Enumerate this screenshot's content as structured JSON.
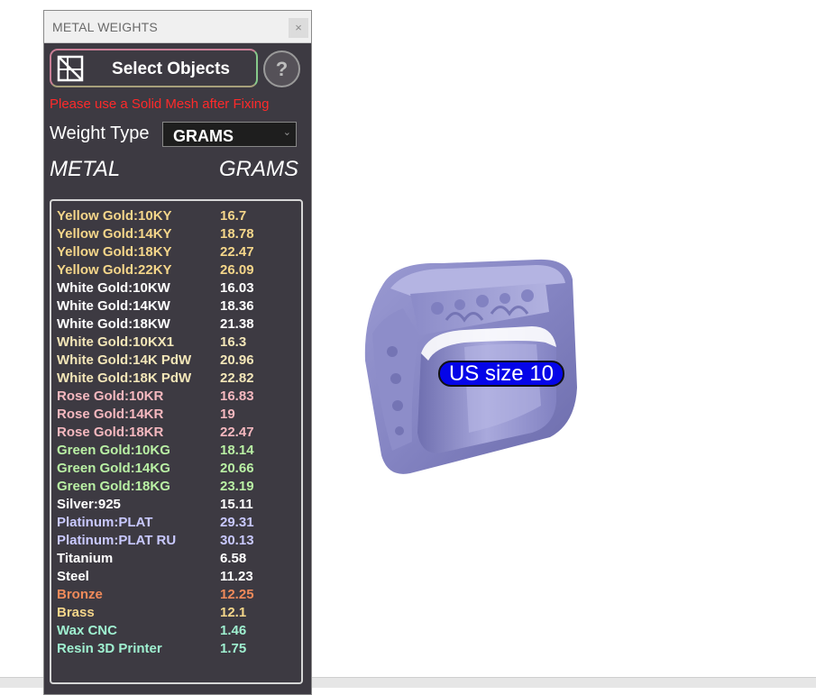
{
  "panel": {
    "title": "METAL WEIGHTS",
    "close_label": "×",
    "select_button": "Select Objects",
    "help_label": "?",
    "warning": "Please use a Solid Mesh after Fixing",
    "weight_type_label": "Weight Type",
    "weight_type_value": "GRAMS",
    "col_metal": "METAL",
    "col_grams": "GRAMS"
  },
  "rows": [
    {
      "metal": "Yellow Gold:10KY",
      "grams": "16.7",
      "color": "#f5d68a"
    },
    {
      "metal": "Yellow Gold:14KY",
      "grams": "18.78",
      "color": "#f5d68a"
    },
    {
      "metal": "Yellow Gold:18KY",
      "grams": "22.47",
      "color": "#f5d68a"
    },
    {
      "metal": "Yellow Gold:22KY",
      "grams": "26.09",
      "color": "#f5d68a"
    },
    {
      "metal": "White Gold:10KW",
      "grams": "16.03",
      "color": "#ffffff"
    },
    {
      "metal": "White Gold:14KW",
      "grams": "18.36",
      "color": "#ffffff"
    },
    {
      "metal": "White Gold:18KW",
      "grams": "21.38",
      "color": "#ffffff"
    },
    {
      "metal": "White Gold:10KX1",
      "grams": "16.3",
      "color": "#f3e6b8"
    },
    {
      "metal": "White Gold:14K PdW",
      "grams": "20.96",
      "color": "#f3e6b8"
    },
    {
      "metal": "White Gold:18K PdW",
      "grams": "22.82",
      "color": "#f3e6b8"
    },
    {
      "metal": "Rose Gold:10KR",
      "grams": "16.83",
      "color": "#f5b8bf"
    },
    {
      "metal": "Rose Gold:14KR",
      "grams": "19",
      "color": "#f5b8bf"
    },
    {
      "metal": "Rose Gold:18KR",
      "grams": "22.47",
      "color": "#f5b8bf"
    },
    {
      "metal": "Green Gold:10KG",
      "grams": "18.14",
      "color": "#b9f0a4"
    },
    {
      "metal": "Green Gold:14KG",
      "grams": "20.66",
      "color": "#b9f0a4"
    },
    {
      "metal": "Green Gold:18KG",
      "grams": "23.19",
      "color": "#b9f0a4"
    },
    {
      "metal": "Silver:925",
      "grams": "15.11",
      "color": "#ffffff"
    },
    {
      "metal": "Platinum:PLAT",
      "grams": "29.31",
      "color": "#c9c9ff"
    },
    {
      "metal": "Platinum:PLAT RU",
      "grams": "30.13",
      "color": "#c9c9ff"
    },
    {
      "metal": "Titanium",
      "grams": "6.58",
      "color": "#ffffff"
    },
    {
      "metal": "Steel",
      "grams": "11.23",
      "color": "#ffffff"
    },
    {
      "metal": "Bronze",
      "grams": "12.25",
      "color": "#f08a5a"
    },
    {
      "metal": "Brass",
      "grams": "12.1",
      "color": "#f5d68a"
    },
    {
      "metal": "Wax  CNC",
      "grams": "1.46",
      "color": "#9ff0d0"
    },
    {
      "metal": "Resin 3D Printer",
      "grams": "1.75",
      "color": "#9ff0d0"
    }
  ],
  "viewport": {
    "size_label": "US size 10"
  }
}
